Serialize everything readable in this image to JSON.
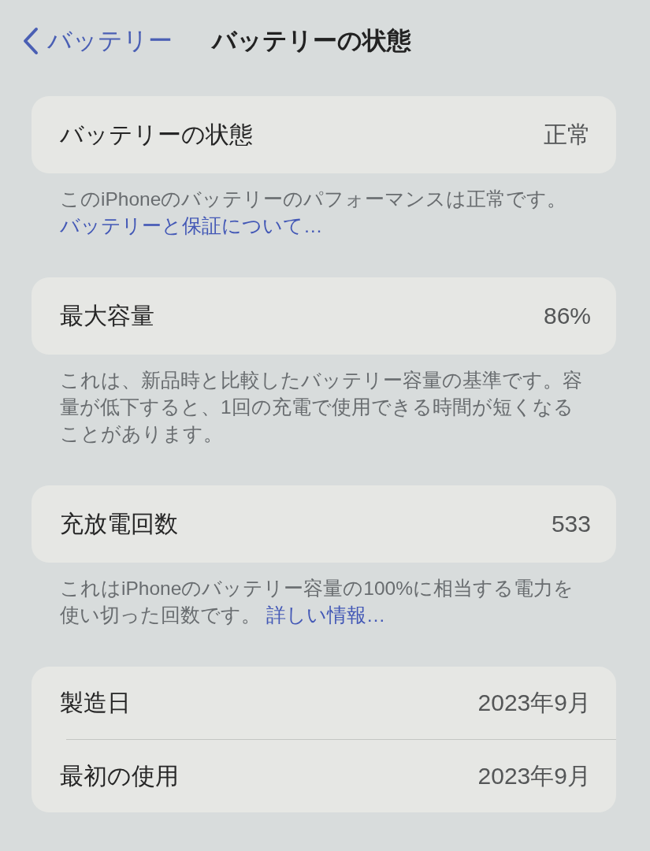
{
  "nav_bar": {
    "back_label": "バッテリー",
    "title": "バッテリーの状態"
  },
  "sections": [
    {
      "rows": [
        {
          "label": "バッテリーの状態",
          "value": "正常"
        }
      ],
      "footer": {
        "text": "このiPhoneのバッテリーのパフォーマンスは正常です。",
        "link": "バッテリーと保証について…"
      }
    },
    {
      "rows": [
        {
          "label": "最大容量",
          "value": "86%"
        }
      ],
      "footer": {
        "text": "これは、新品時と比較したバッテリー容量の基準です。容量が低下すると、1回の充電で使用できる時間が短くなることがあります。"
      }
    },
    {
      "rows": [
        {
          "label": "充放電回数",
          "value": "533"
        }
      ],
      "footer": {
        "text": "これはiPhoneのバッテリー容量の100%に相当する電力を使い切った回数です。",
        "link": "詳しい情報…"
      }
    },
    {
      "rows": [
        {
          "label": "製造日",
          "value": "2023年9月"
        },
        {
          "label": "最初の使用",
          "value": "2023年9月"
        }
      ]
    }
  ]
}
